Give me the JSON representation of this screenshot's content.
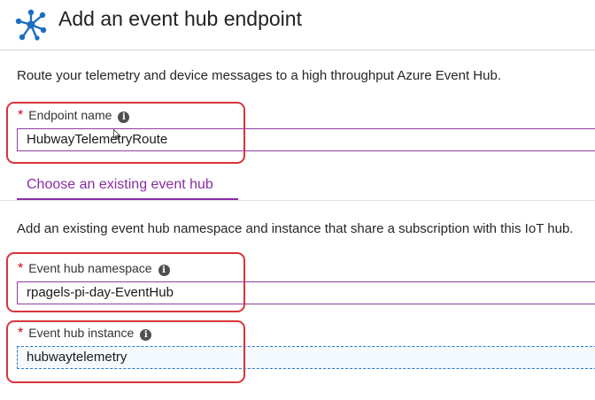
{
  "header": {
    "title": "Add an event hub endpoint",
    "icon": "event-hub-icon"
  },
  "description": "Route your telemetry and device messages to a high throughput Azure Event Hub.",
  "endpoint_name": {
    "required_mark": "*",
    "label": "Endpoint name",
    "value": "HubwayTelemetryRoute"
  },
  "tab": {
    "label": "Choose an existing event hub"
  },
  "existing_description": "Add an existing event hub namespace and instance that share a subscription with this IoT hub.",
  "namespace": {
    "required_mark": "*",
    "label": "Event hub namespace",
    "value": "rpagels-pi-day-EventHub"
  },
  "instance": {
    "required_mark": "*",
    "label": "Event hub instance",
    "value": "hubwaytelemetry"
  },
  "info_icon_glyph": "i",
  "colors": {
    "accent": "#8a2da5",
    "required": "#d0021b",
    "annotation": "#d9343a",
    "focus": "#2b79c2",
    "icon": "#1b6ec2"
  }
}
